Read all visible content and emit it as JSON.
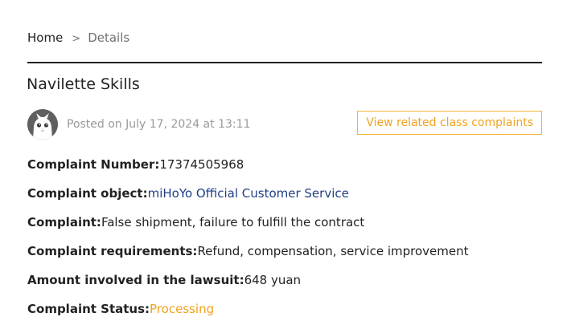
{
  "breadcrumb": {
    "home": "Home",
    "separator": ">",
    "current": "Details"
  },
  "complaint": {
    "title": "Navilette Skills",
    "posted": "Posted on July 17, 2024 at 13:11",
    "related_button": "View related class complaints",
    "avatar_icon": "cat-avatar-icon",
    "fields": {
      "number_label": "Complaint Number:",
      "number_value": "17374505968",
      "object_label": "Complaint object:",
      "object_value": "miHoYo Official Customer Service",
      "complaint_label": "Complaint:",
      "complaint_value": "False shipment, failure to fulfill the contract",
      "requirements_label": "Complaint requirements:",
      "requirements_value": "Refund, compensation, service improvement",
      "amount_label": "Amount involved in the lawsuit:",
      "amount_value": "648 yuan",
      "status_label": "Complaint Status:",
      "status_value": "Processing"
    }
  },
  "colors": {
    "accent": "#f0a21e",
    "link": "#1f3f86",
    "divider": "#222222",
    "muted": "#9a9a9a"
  }
}
